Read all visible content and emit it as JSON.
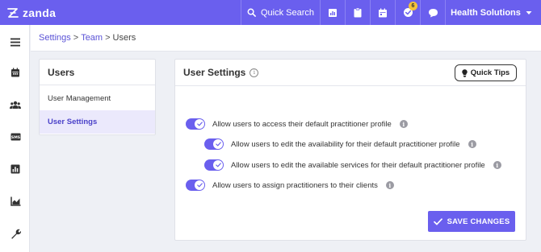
{
  "app": {
    "logo_text": "zanda"
  },
  "topbar": {
    "search_label": "Quick Search",
    "icons": [
      "reports-icon",
      "clipboard-icon",
      "calendar-icon",
      "tasks-icon",
      "chat-icon"
    ],
    "tasks_badge": "6",
    "business_name": "Health Solutions"
  },
  "sidebar": {
    "icons": [
      "menu-icon",
      "calendar-icon",
      "clients-icon",
      "sms-icon",
      "reports-icon",
      "analytics-icon",
      "settings-wrench-icon"
    ]
  },
  "breadcrumb": {
    "settings": "Settings",
    "team": "Team",
    "current": "Users",
    "separator": ">"
  },
  "subnav": {
    "title": "Users",
    "items": [
      {
        "label": "User Management",
        "active": false
      },
      {
        "label": "User Settings",
        "active": true
      }
    ]
  },
  "card": {
    "title": "User Settings",
    "info_glyph": "i",
    "quick_tips_label": "Quick Tips",
    "settings": [
      {
        "label": "Allow users to access their default practitioner profile",
        "enabled": true
      },
      {
        "label": "Allow users to edit the availability for their default practitioner profile",
        "enabled": true
      },
      {
        "label": "Allow users to edit the available services for their default practitioner profile",
        "enabled": true
      },
      {
        "label": "Allow users to assign practitioners to their clients",
        "enabled": true
      }
    ],
    "save_label": "SAVE CHANGES"
  },
  "colors": {
    "accent": "#6a5fee",
    "active_bg": "#ebe9fc",
    "link": "#5a52d6"
  }
}
